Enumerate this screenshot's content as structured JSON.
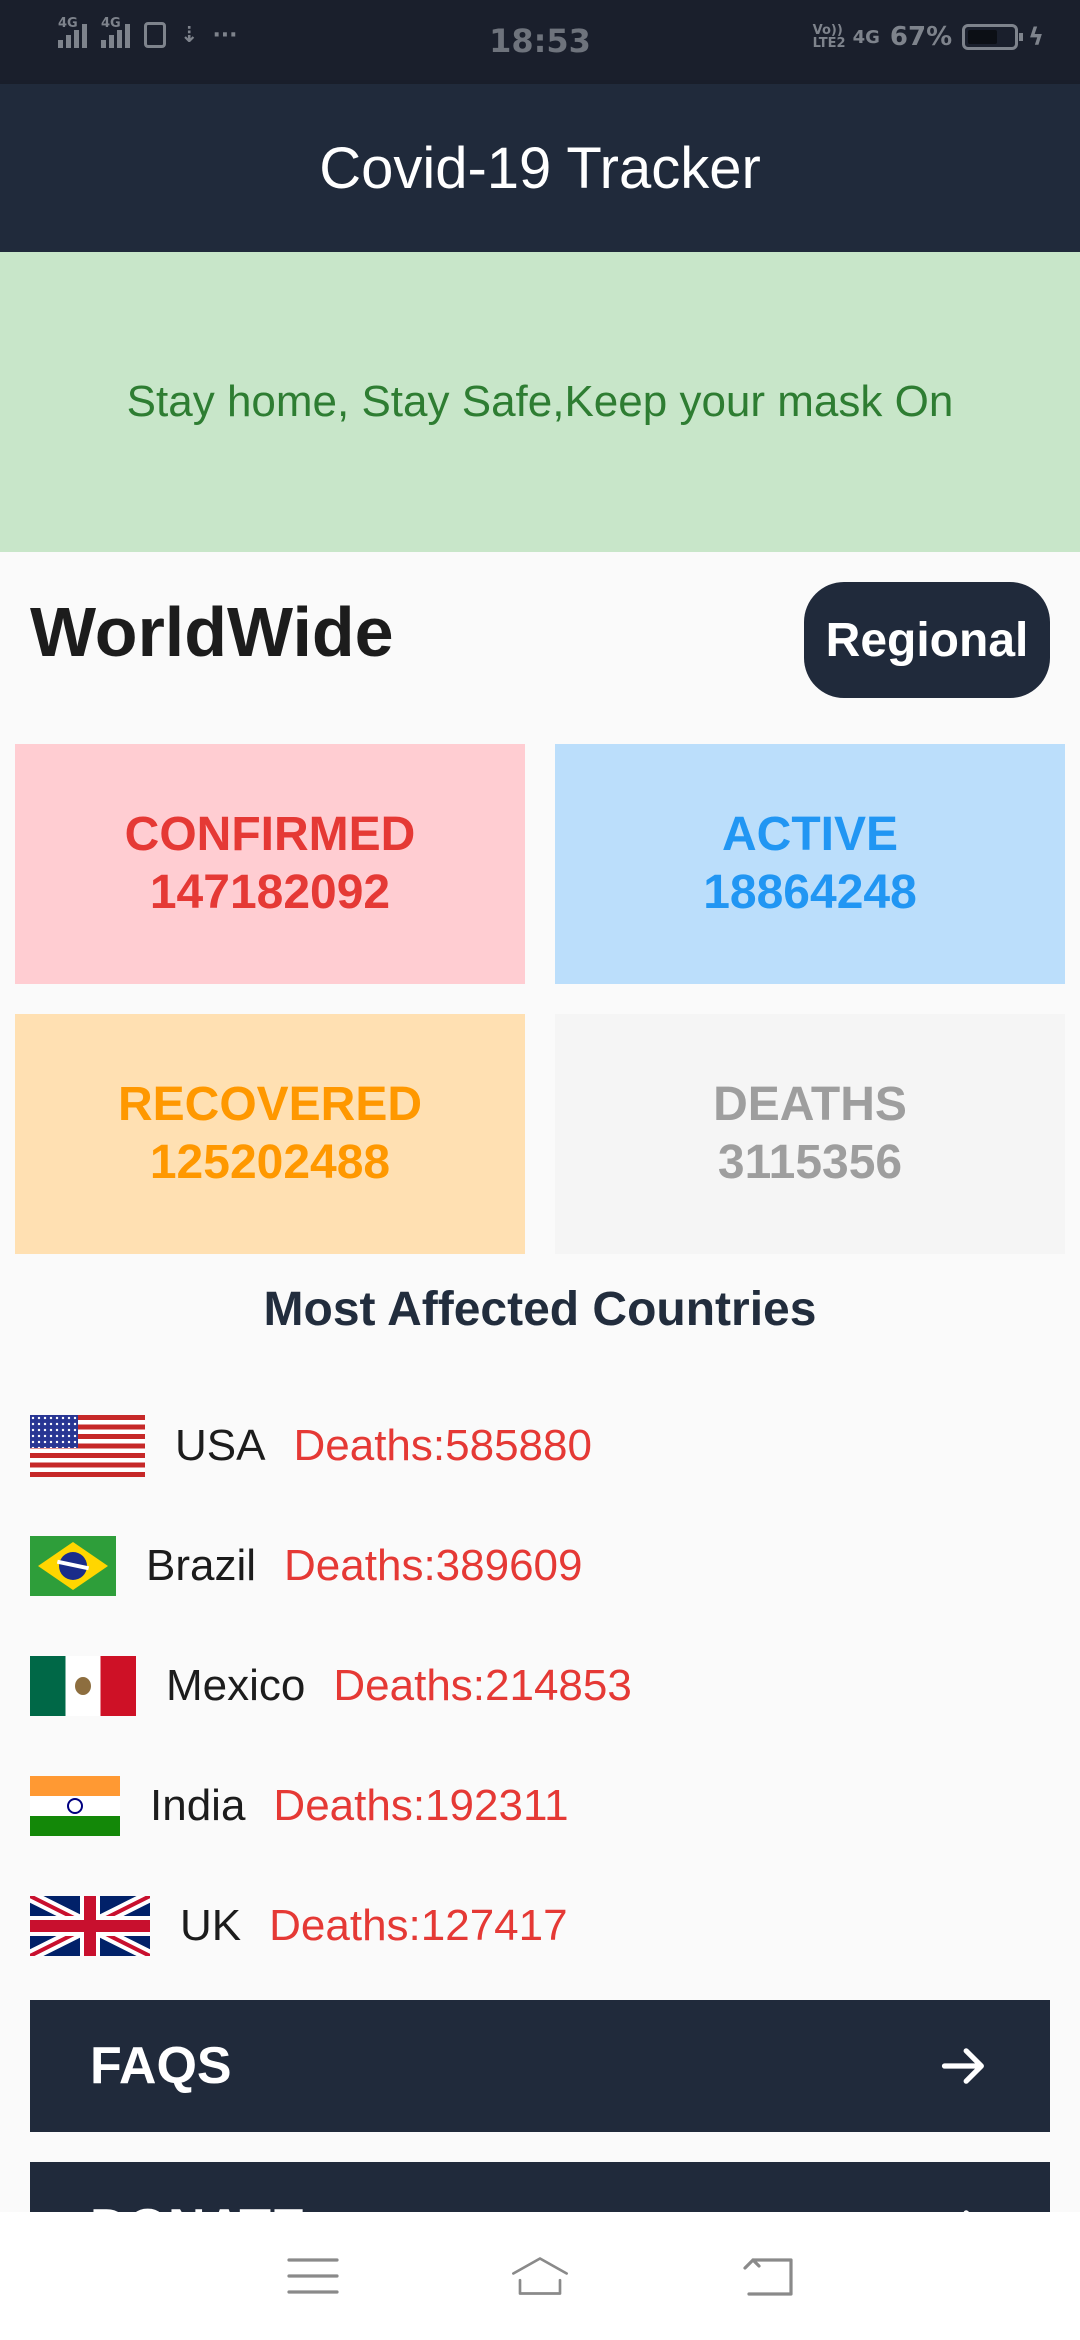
{
  "status_bar": {
    "time": "18:53",
    "battery": "67%",
    "battery_level": 0.67,
    "network_left": [
      "4G",
      "4G"
    ],
    "volte": "Vo)) LTE2",
    "net_right": "4G"
  },
  "app_bar": {
    "title": "Covid-19 Tracker"
  },
  "banner": {
    "text": "Stay home, Stay Safe,Keep your mask On"
  },
  "section": {
    "title": "WorldWide",
    "regional_label": "Regional"
  },
  "stats": {
    "confirmed": {
      "label": "CONFIRMED",
      "value": "147182092",
      "color": "#e53935",
      "bg": "#ffcdd2"
    },
    "active": {
      "label": "ACTIVE",
      "value": "18864248",
      "color": "#2196f3",
      "bg": "#bbdefb"
    },
    "recovered": {
      "label": "RECOVERED",
      "value": "125202488",
      "color": "#ff9800",
      "bg": "#ffe0b2"
    },
    "deaths": {
      "label": "DEATHS",
      "value": "3115356",
      "color": "#9e9e9e",
      "bg": "#f5f5f5"
    }
  },
  "most_affected": {
    "title": "Most Affected Countries",
    "countries": [
      {
        "name": "USA",
        "deaths": "Deaths:585880",
        "flag": "usa-flag-icon"
      },
      {
        "name": "Brazil",
        "deaths": "Deaths:389609",
        "flag": "brazil-flag-icon"
      },
      {
        "name": "Mexico",
        "deaths": "Deaths:214853",
        "flag": "mexico-flag-icon"
      },
      {
        "name": "India",
        "deaths": "Deaths:192311",
        "flag": "india-flag-icon"
      },
      {
        "name": "UK",
        "deaths": "Deaths:127417",
        "flag": "uk-flag-icon"
      }
    ]
  },
  "actions": {
    "faqs_label": "FAQS",
    "donate_label": "DONATE",
    "icon": "arrow-right-icon"
  },
  "nav": {
    "icons": [
      "menu-icon",
      "home-icon",
      "back-icon"
    ]
  },
  "colors": {
    "primary_dark": "#202a3b",
    "banner_bg": "#c8e6c9",
    "banner_text": "#2e7d32",
    "death_text": "#e53935"
  }
}
